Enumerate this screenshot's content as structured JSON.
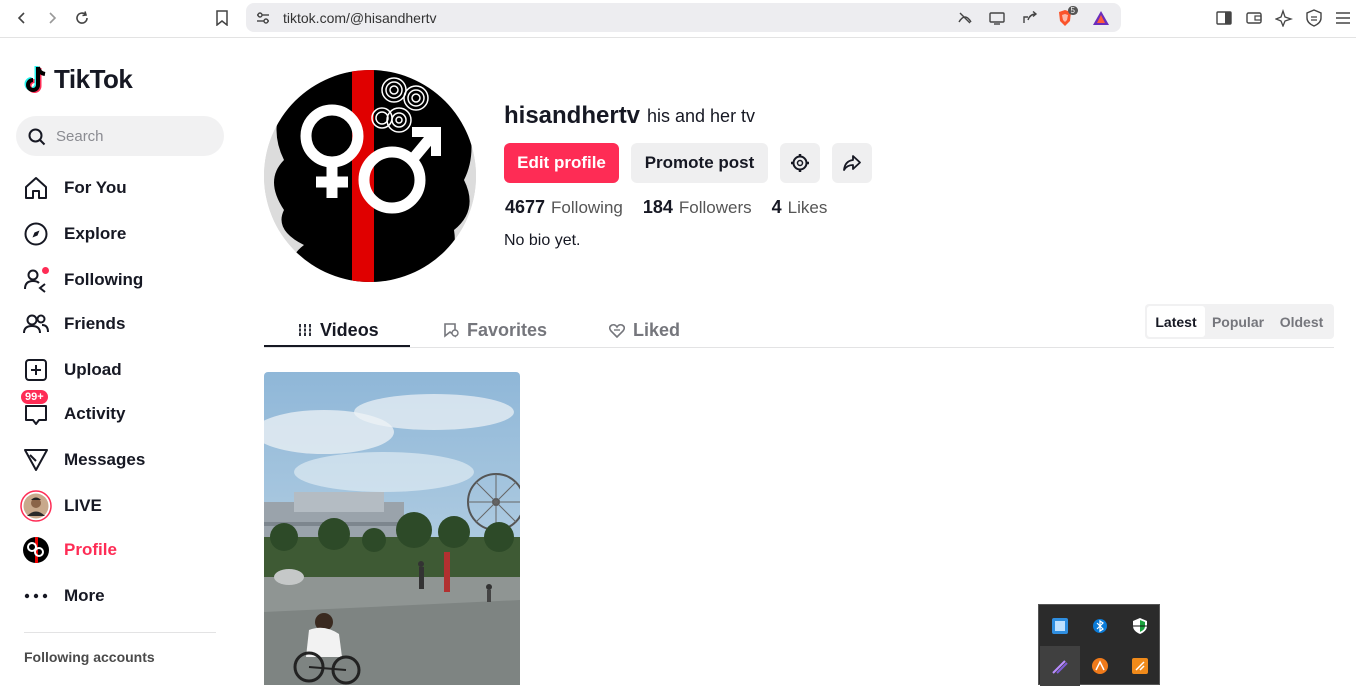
{
  "browser": {
    "url": "tiktok.com/@hisandhertv",
    "brave_badge": "5"
  },
  "sidebar": {
    "logo_text": "TikTok",
    "search_placeholder": "Search",
    "items": [
      {
        "label": "For You",
        "icon": "home-icon"
      },
      {
        "label": "Explore",
        "icon": "compass-icon"
      },
      {
        "label": "Following",
        "icon": "following-users-icon"
      },
      {
        "label": "Friends",
        "icon": "friends-icon"
      },
      {
        "label": "Upload",
        "icon": "upload-icon"
      },
      {
        "label": "Activity",
        "icon": "activity-icon",
        "badge": "99+"
      },
      {
        "label": "Messages",
        "icon": "messages-icon"
      },
      {
        "label": "LIVE",
        "icon": "live-avatar-icon"
      },
      {
        "label": "Profile",
        "icon": "profile-avatar-icon"
      },
      {
        "label": "More",
        "icon": "more-dots-icon"
      }
    ],
    "following_accounts_title": "Following accounts"
  },
  "profile": {
    "username": "hisandhertv",
    "nickname": "his and her tv",
    "edit_profile": "Edit profile",
    "promote_post": "Promote post",
    "following_count": "4677",
    "following_label": "Following",
    "followers_count": "184",
    "followers_label": "Followers",
    "likes_count": "4",
    "likes_label": "Likes",
    "bio": "No bio yet."
  },
  "tabs": [
    {
      "label": "Videos",
      "active": true
    },
    {
      "label": "Favorites",
      "active": false
    },
    {
      "label": "Liked",
      "active": false
    }
  ],
  "sort_options": [
    {
      "label": "Latest",
      "active": true
    },
    {
      "label": "Popular",
      "active": false
    },
    {
      "label": "Oldest",
      "active": false
    }
  ],
  "colors": {
    "accent": "#fe2c55",
    "text": "#161823"
  }
}
